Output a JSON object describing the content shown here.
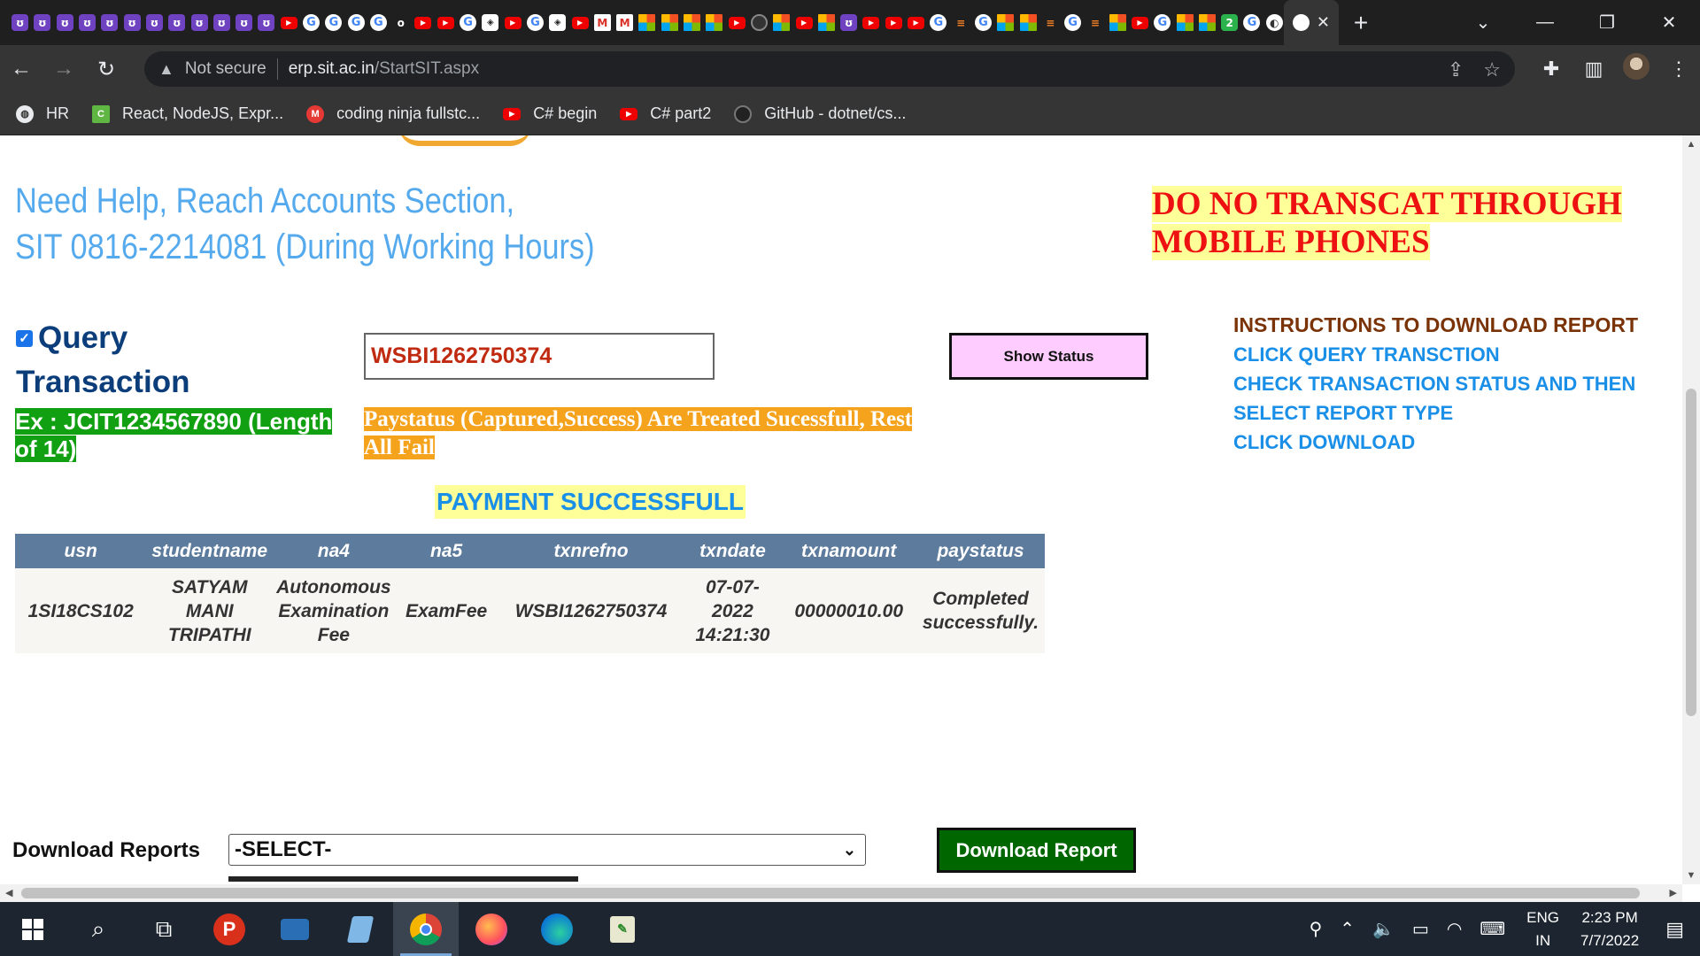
{
  "browser": {
    "tabs": [
      "p",
      "p",
      "p",
      "p",
      "p",
      "p",
      "p",
      "p",
      "p",
      "p",
      "p",
      "p",
      "yt",
      "g",
      "g",
      "g",
      "g",
      "o",
      "yt",
      "yt",
      "g",
      "lg",
      "yt",
      "g",
      "lg",
      "yt",
      "gm",
      "gm",
      "ms",
      "ms",
      "ms",
      "ms",
      "yt",
      "gh",
      "ms",
      "yt",
      "ms",
      "p",
      "yt",
      "yt",
      "yt",
      "g",
      "so",
      "g",
      "ms",
      "ms",
      "so",
      "g",
      "so",
      "ms",
      "yt",
      "g",
      "ms",
      "ms",
      "n2",
      "g",
      "sd"
    ],
    "active_tab_close": "✕",
    "new_tab": "+",
    "url_warning": "Not secure",
    "url_host": "erp.sit.ac.in",
    "url_path": "/StartSIT.aspx",
    "bookmarks": [
      {
        "icon": "globe",
        "label": "HR"
      },
      {
        "icon": "cn",
        "label": "React, NodeJS, Expr..."
      },
      {
        "icon": "m",
        "label": "coding ninja fullstc..."
      },
      {
        "icon": "yt",
        "label": "C# begin"
      },
      {
        "icon": "yt",
        "label": "C# part2"
      },
      {
        "icon": "gh",
        "label": "GitHub - dotnet/cs..."
      }
    ]
  },
  "page": {
    "help_line1": "Need Help, Reach Accounts Section,",
    "help_line2": "SIT  0816-2214081 (During Working Hours)",
    "mobile_warning_line1": "DO NO TRANSCAT THROUGH",
    "mobile_warning_line2": "MOBILE PHONES",
    "query_label_line1": "Query",
    "query_label_line2": "Transaction",
    "query_checked": true,
    "example_text": "Ex : JCIT1234567890 (Length of 14)",
    "txn_input_value": "WSBI1262750374",
    "show_status_label": "Show Status",
    "paystatus_note": "Paystatus (Captured,Success) Are Treated Sucessfull, Rest All Fail",
    "payment_result": "PAYMENT SUCCESSFULL",
    "instructions": {
      "heading": "INSTRUCTIONS TO DOWNLOAD REPORT",
      "steps": [
        "CLICK QUERY TRANSCTION",
        "CHECK TRANSACTION STATUS AND THEN",
        "SELECT REPORT TYPE",
        "CLICK DOWNLOAD"
      ]
    },
    "table": {
      "headers": [
        "usn",
        "studentname",
        "na4",
        "na5",
        "txnrefno",
        "txndate",
        "txnamount",
        "paystatus"
      ],
      "row": [
        "1SI18CS102",
        "SATYAM MANI TRIPATHI",
        "Autonomous Examination Fee",
        "ExamFee",
        "WSBI1262750374",
        "07-07-2022 14:21:30",
        "00000010.00",
        "Completed successfully."
      ]
    },
    "download_label": "Download Reports",
    "download_select_value": "-SELECT-",
    "download_button": "Download Report"
  },
  "taskbar": {
    "lang_line1": "ENG",
    "lang_line2": "IN",
    "time": "2:23 PM",
    "date": "7/7/2022"
  }
}
